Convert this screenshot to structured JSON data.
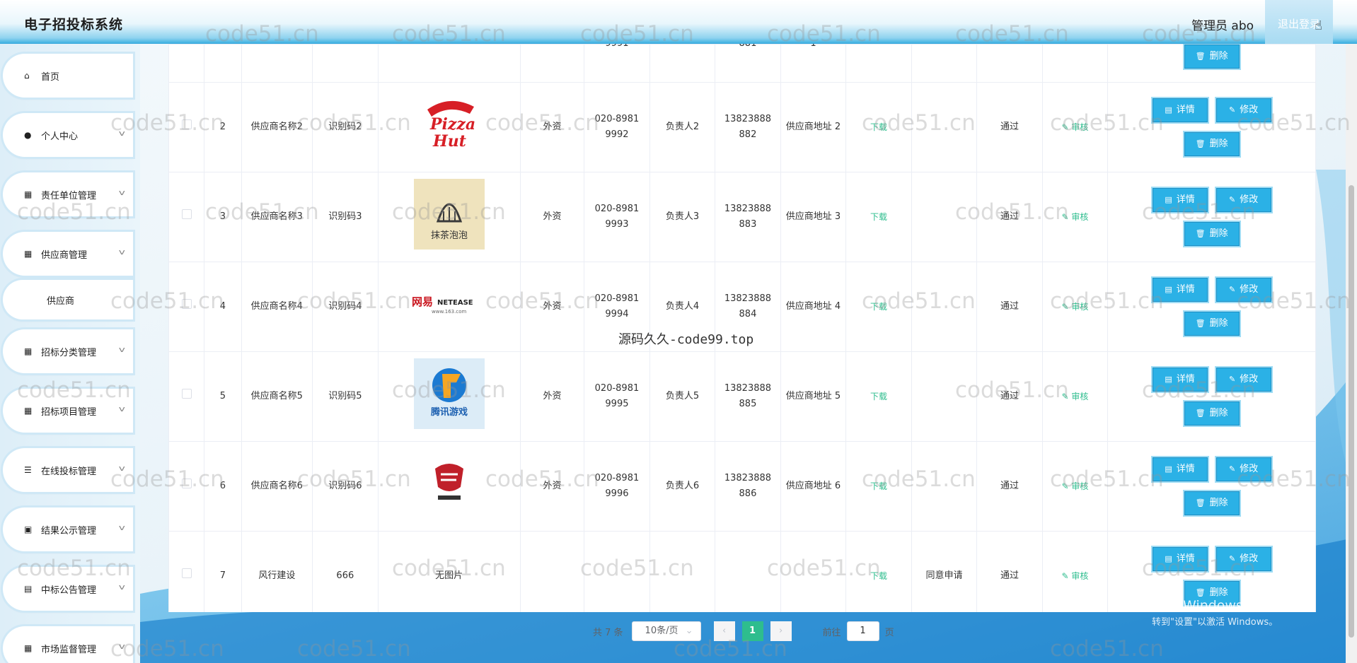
{
  "app": {
    "title": "电子招投标系统",
    "admin_label": "管理员 abo",
    "logout_label": "退出登录"
  },
  "sidebar": {
    "items": [
      {
        "label": "首页",
        "icon": "home-icon",
        "glyph": "⌂",
        "chevron": false
      },
      {
        "label": "个人中心",
        "icon": "user-icon",
        "glyph": "●",
        "chevron": true
      },
      {
        "label": "责任单位管理",
        "icon": "grid-icon",
        "glyph": "▦",
        "chevron": true
      },
      {
        "label": "供应商管理",
        "icon": "grid-icon",
        "glyph": "▦",
        "chevron": true
      },
      {
        "label": "供应商",
        "icon": "",
        "glyph": "",
        "chevron": false,
        "sub": true
      },
      {
        "label": "招标分类管理",
        "icon": "grid-icon",
        "glyph": "▦",
        "chevron": true
      },
      {
        "label": "招标项目管理",
        "icon": "grid-icon",
        "glyph": "▦",
        "chevron": true
      },
      {
        "label": "在线投标管理",
        "icon": "list-icon",
        "glyph": "☰",
        "chevron": true
      },
      {
        "label": "结果公示管理",
        "icon": "ticket-icon",
        "glyph": "▣",
        "chevron": true
      },
      {
        "label": "中标公告管理",
        "icon": "briefcase-icon",
        "glyph": "▤",
        "chevron": true
      },
      {
        "label": "市场监督管理",
        "icon": "grid-icon",
        "glyph": "▦",
        "chevron": true
      }
    ]
  },
  "table": {
    "partial_row": {
      "phone_tail": "9991",
      "mobile_tail": "881",
      "addr_tail": "1"
    },
    "rows": [
      {
        "index": "2",
        "name": "供应商名称2",
        "code": "识别码2",
        "logo": "pizza-hut-logo",
        "type": "外资",
        "phone": "020-8981 9992",
        "contact": "负责人2",
        "mobile": "13823888 882",
        "address": "供应商地址 2",
        "file": "下载",
        "apply": "",
        "status": "通过"
      },
      {
        "index": "3",
        "name": "供应商名称3",
        "code": "识别码3",
        "logo": "tea-shop-logo",
        "type": "外资",
        "phone": "020-8981 9993",
        "contact": "负责人3",
        "mobile": "13823888 883",
        "address": "供应商地址 3",
        "file": "下载",
        "apply": "",
        "status": "通过"
      },
      {
        "index": "4",
        "name": "供应商名称4",
        "code": "识别码4",
        "logo": "netease-logo",
        "type": "外资",
        "phone": "020-8981 9994",
        "contact": "负责人4",
        "mobile": "13823888 884",
        "address": "供应商地址 4",
        "file": "下载",
        "apply": "",
        "status": "通过"
      },
      {
        "index": "5",
        "name": "供应商名称5",
        "code": "识别码5",
        "logo": "tencent-games-logo",
        "type": "外资",
        "phone": "020-8981 9995",
        "contact": "负责人5",
        "mobile": "13823888 885",
        "address": "供应商地址 5",
        "file": "下载",
        "apply": "",
        "status": "通过"
      },
      {
        "index": "6",
        "name": "供应商名称6",
        "code": "识别码6",
        "logo": "sports-logo",
        "type": "外资",
        "phone": "020-8981 9996",
        "contact": "负责人6",
        "mobile": "13823888 886",
        "address": "供应商地址 6",
        "file": "下载",
        "apply": "",
        "status": "通过"
      },
      {
        "index": "7",
        "name": "风行建设",
        "code": "666",
        "logo": "",
        "logo_text": "无图片",
        "type": "",
        "phone": "",
        "contact": "",
        "mobile": "",
        "address": "",
        "file": "下载",
        "apply": "同意申请",
        "status": "通过"
      }
    ],
    "audit_label": "审核",
    "detail_label": "详情",
    "edit_label": "修改",
    "delete_label": "删除"
  },
  "logo_text": {
    "pizza_top": "Pizza",
    "pizza_bottom": "Hut",
    "netease_cn": "网易",
    "netease_en": "NETEASE",
    "netease_url": "www.163.com",
    "tencent": "腾讯游戏",
    "tea": "抹茶泡泡"
  },
  "pagination": {
    "total": "共 7 条",
    "page_size": "10条/页",
    "current": "1",
    "goto_label": "前往",
    "goto_value": "1",
    "page_unit": "页"
  },
  "overlay": {
    "center_watermark": "源码久久-code99.top",
    "watermark": "code51.cn",
    "activate_title": "激活 Windows",
    "activate_sub": "转到\"设置\"以激活 Windows。"
  }
}
